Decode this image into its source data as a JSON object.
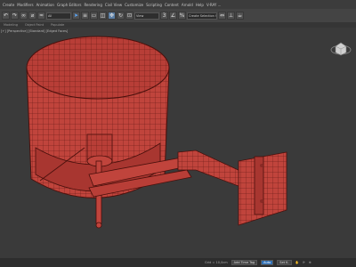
{
  "menu": [
    "Create",
    "Modifiers",
    "Animation",
    "Graph Editors",
    "Rendering",
    "Civil View",
    "Customize",
    "Scripting",
    "Content",
    "Arnold",
    "Help",
    "V-RAY ..."
  ],
  "toolbar": {
    "selection_filter": "All",
    "named_selection": "Create Selection Se",
    "view_dropdown": "View"
  },
  "ribbon": [
    "Modeling",
    "Object Paint",
    "Populate"
  ],
  "viewport": {
    "label": "[+] [Perspective] [Standard] [Edged Faces]"
  },
  "status": {
    "grid": "Grid = 10,0cm",
    "add_time_tag": "Add Time Tag",
    "auto": "Auto",
    "set_key": "Set K."
  },
  "icons": [
    "undo-icon",
    "redo-icon",
    "link-icon",
    "unlink-icon",
    "bind-icon",
    "select-icon",
    "select-by-name-icon",
    "rect-region-icon",
    "window-crossing-icon",
    "move-icon",
    "rotate-icon",
    "scale-icon",
    "snap-icon",
    "angle-snap-icon",
    "percent-snap-icon",
    "mirror-icon",
    "align-icon",
    "render-icon",
    "viewcube-icon",
    "pan-icon",
    "orbit-icon",
    "zoom-icon"
  ],
  "colors": {
    "model": "#c0443c",
    "wire": "#5a1410",
    "viewport_bg": "#3a3a3a",
    "accent": "#2e6fb5"
  }
}
